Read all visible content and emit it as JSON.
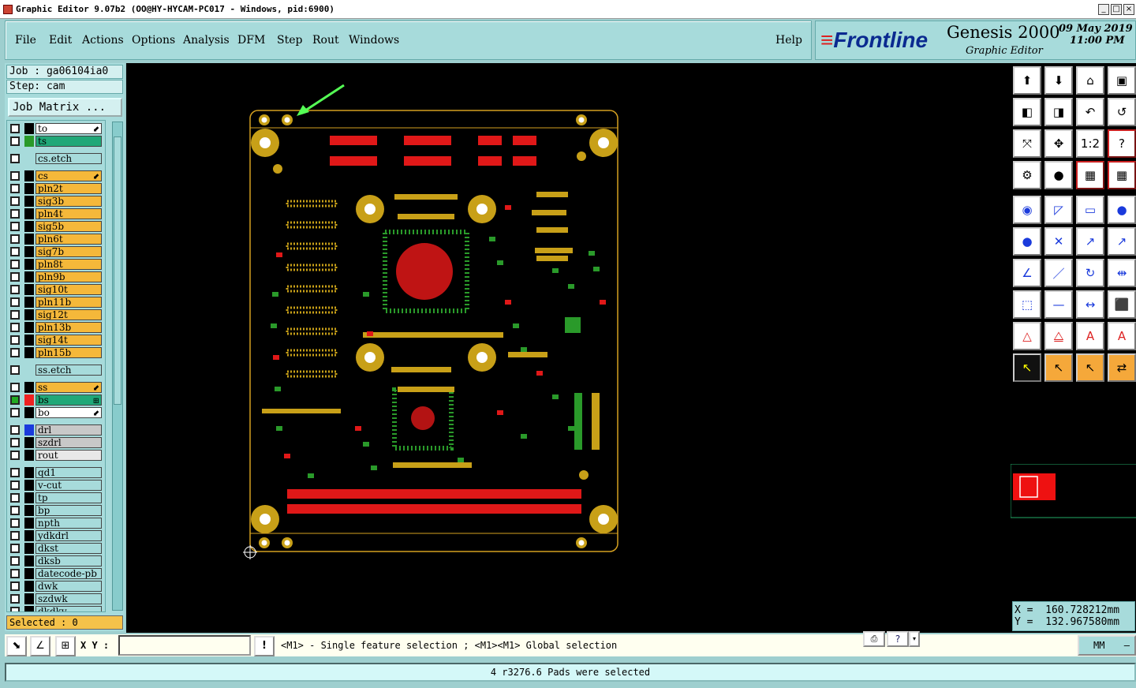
{
  "window": {
    "title": "Graphic Editor 9.07b2 (OO@HY-HYCAM-PC017 - Windows, pid:6900)"
  },
  "menu": {
    "items": [
      "File",
      "Edit",
      "Actions",
      "Options",
      "Analysis",
      "DFM",
      "Step",
      "Rout",
      "Windows"
    ],
    "help": "Help"
  },
  "brand": {
    "logo": "Frontline",
    "product": "Genesis 2000",
    "subtitle": "Graphic Editor",
    "date": "09 May 2019",
    "time": "11:00 PM"
  },
  "job": {
    "job": "Job : ga06104ia0",
    "step": "Step: cam",
    "matrix": "Job Matrix ..."
  },
  "layers": [
    {
      "name": "to",
      "bg": "#ffffff",
      "sw": "#000000",
      "mark": "⬋"
    },
    {
      "name": "ts",
      "bg": "#20a878",
      "sw": "#2a9a2a",
      "mark": ""
    },
    {
      "name": "cs.etch",
      "bg": "#a7dbdb",
      "sw": "",
      "mark": ""
    },
    {
      "name": "cs",
      "bg": "#f5b83a",
      "sw": "#000000",
      "mark": "⬋"
    },
    {
      "name": "pln2t",
      "bg": "#f5b83a",
      "sw": "#000000",
      "mark": ""
    },
    {
      "name": "sig3b",
      "bg": "#f5b83a",
      "sw": "#000000",
      "mark": ""
    },
    {
      "name": "pln4t",
      "bg": "#f5b83a",
      "sw": "#000000",
      "mark": ""
    },
    {
      "name": "sig5b",
      "bg": "#f5b83a",
      "sw": "#000000",
      "mark": ""
    },
    {
      "name": "pln6t",
      "bg": "#f5b83a",
      "sw": "#000000",
      "mark": ""
    },
    {
      "name": "sig7b",
      "bg": "#f5b83a",
      "sw": "#000000",
      "mark": ""
    },
    {
      "name": "pln8t",
      "bg": "#f5b83a",
      "sw": "#000000",
      "mark": ""
    },
    {
      "name": "pln9b",
      "bg": "#f5b83a",
      "sw": "#000000",
      "mark": ""
    },
    {
      "name": "sig10t",
      "bg": "#f5b83a",
      "sw": "#000000",
      "mark": ""
    },
    {
      "name": "pln11b",
      "bg": "#f5b83a",
      "sw": "#000000",
      "mark": ""
    },
    {
      "name": "sig12t",
      "bg": "#f5b83a",
      "sw": "#000000",
      "mark": ""
    },
    {
      "name": "pln13b",
      "bg": "#f5b83a",
      "sw": "#000000",
      "mark": ""
    },
    {
      "name": "sig14t",
      "bg": "#f5b83a",
      "sw": "#000000",
      "mark": ""
    },
    {
      "name": "pln15b",
      "bg": "#f5b83a",
      "sw": "#000000",
      "mark": ""
    },
    {
      "name": "ss.etch",
      "bg": "#a7dbdb",
      "sw": "",
      "mark": ""
    },
    {
      "name": "ss",
      "bg": "#f5b83a",
      "sw": "#000000",
      "mark": "⬋"
    },
    {
      "name": "bs",
      "bg": "#20a878",
      "sw": "#ee2222",
      "mark": "⊞"
    },
    {
      "name": "bo",
      "bg": "#ffffff",
      "sw": "#000000",
      "mark": "⬋"
    },
    {
      "name": "drl",
      "bg": "#c8c8c8",
      "sw": "#1a3adc",
      "mark": ""
    },
    {
      "name": "szdrl",
      "bg": "#c8c8c8",
      "sw": "#000000",
      "mark": ""
    },
    {
      "name": "rout",
      "bg": "#e8e8e8",
      "sw": "#000000",
      "mark": ""
    },
    {
      "name": "qd1",
      "bg": "#a7dbdb",
      "sw": "#000000",
      "mark": ""
    },
    {
      "name": "v-cut",
      "bg": "#a7dbdb",
      "sw": "#000000",
      "mark": ""
    },
    {
      "name": "tp",
      "bg": "#a7dbdb",
      "sw": "#000000",
      "mark": ""
    },
    {
      "name": "bp",
      "bg": "#a7dbdb",
      "sw": "#000000",
      "mark": ""
    },
    {
      "name": "npth",
      "bg": "#a7dbdb",
      "sw": "#000000",
      "mark": ""
    },
    {
      "name": "ydkdrl",
      "bg": "#a7dbdb",
      "sw": "#000000",
      "mark": ""
    },
    {
      "name": "dkst",
      "bg": "#a7dbdb",
      "sw": "#000000",
      "mark": ""
    },
    {
      "name": "dksb",
      "bg": "#a7dbdb",
      "sw": "#000000",
      "mark": ""
    },
    {
      "name": "datecode-pb",
      "bg": "#a7dbdb",
      "sw": "#000000",
      "mark": ""
    },
    {
      "name": "dwk",
      "bg": "#a7dbdb",
      "sw": "#000000",
      "mark": ""
    },
    {
      "name": "szdwk",
      "bg": "#a7dbdb",
      "sw": "#000000",
      "mark": ""
    },
    {
      "name": "dkdkv",
      "bg": "#a7dbdb",
      "sw": "#000000",
      "mark": ""
    }
  ],
  "selected": "Selected : 0",
  "coords": {
    "x": "X =  160.728212mm",
    "y": "Y =  132.967580mm"
  },
  "cmd": {
    "xy_label": "X Y :",
    "xy_value": "",
    "hint": "<M1> - Single feature selection ; <M1><M1> Global selection",
    "units": "MM"
  },
  "status": "4 r3276.6 Pads were selected",
  "colors": {
    "board_outline": "#d4a020",
    "copper": "#c8a018",
    "pad_red": "#e01818",
    "pad_green": "#2a9a2a",
    "cursor": "#55ff55"
  },
  "icons": {
    "tool_rows": [
      [
        "layer-up-icon",
        "layer-down-icon",
        "home-icon",
        "split-view-icon"
      ],
      [
        "pan-left-icon",
        "pan-right-icon",
        "undo-zoom-icon",
        "redraw-icon"
      ],
      [
        "fit-screen-icon",
        "zoom-home-icon",
        "one-to-one-icon",
        "help-query-icon"
      ],
      [
        "snap-tools-icon",
        "measure-probe-icon",
        "layer-stack-icon",
        "layer-compare-icon"
      ],
      [
        "add-pad-icon",
        "add-line-icon",
        "ruler-icon",
        "add-circle-icon"
      ],
      [
        "connect-icon",
        "delete-icon",
        "move-icon",
        "copy-icon"
      ],
      [
        "add-arc-icon",
        "line-edit-icon",
        "rotate-icon",
        "mirror-icon"
      ],
      [
        "resize-icon",
        "segment-icon",
        "stretch-icon",
        "transform-icon"
      ],
      [
        "polygon-icon",
        "polygon-edit-icon",
        "surface-icon",
        "surface-fill-icon"
      ],
      [
        "select-pointer-icon",
        "select-box-icon",
        "select-cross-icon",
        "select-net-icon"
      ]
    ]
  }
}
